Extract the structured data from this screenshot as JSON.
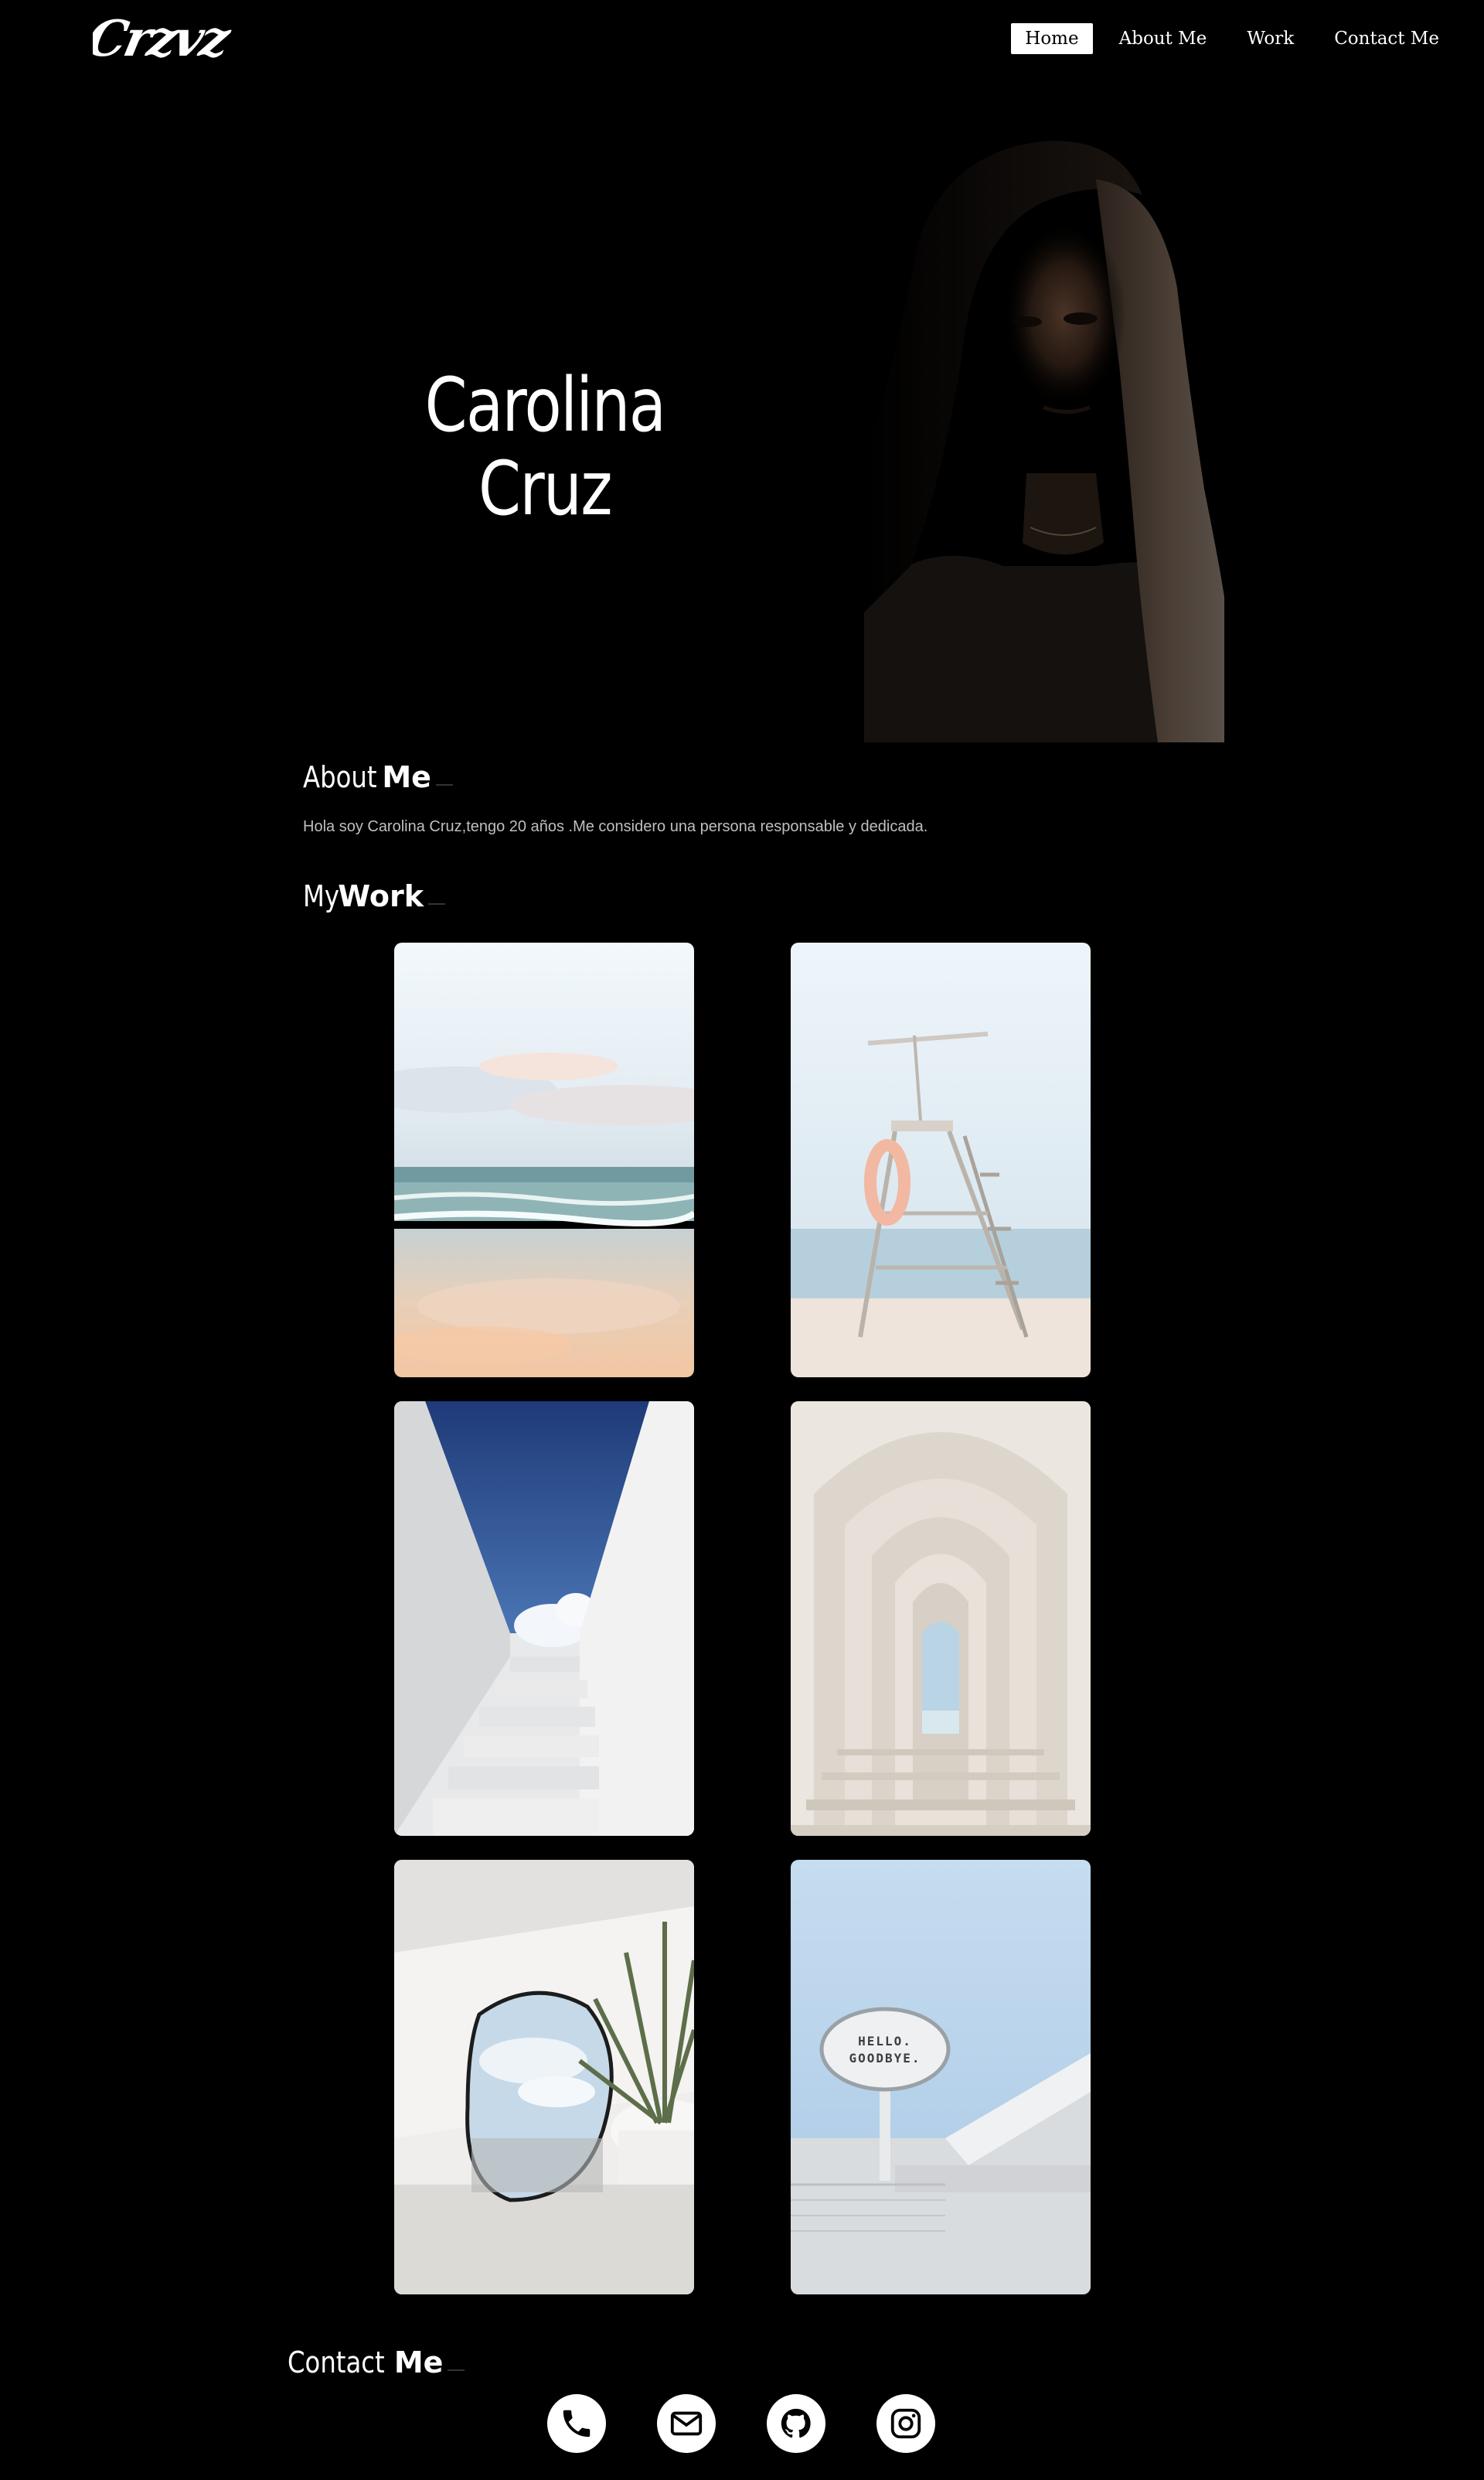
{
  "header": {
    "logo_text": "Crzvz",
    "nav": [
      {
        "label": "Home",
        "active": true
      },
      {
        "label": "About Me",
        "active": false
      },
      {
        "label": "Work",
        "active": false
      },
      {
        "label": "Contact Me",
        "active": false
      }
    ]
  },
  "hero": {
    "name_line1": "Carolina",
    "name_line2": "Cruz",
    "portrait_alt": "portrait"
  },
  "about": {
    "title_light": "About",
    "title_bold": "Me",
    "text": "Hola soy Carolina Cruz,tengo 20 años .Me considero una persona responsable y dedicada."
  },
  "work": {
    "title_light": "My",
    "title_bold": "Work",
    "items": [
      {
        "subject": "beach-shore-photo"
      },
      {
        "subject": "lifeguard-chair-photo"
      },
      {
        "subject": "white-staircase-photo"
      },
      {
        "subject": "arched-corridor-photo"
      },
      {
        "subject": "mirror-and-plant-photo"
      },
      {
        "subject": "hello-goodbye-sign-photo",
        "sign_line1": "HELLO.",
        "sign_line2": "GOODBYE."
      }
    ]
  },
  "contact": {
    "title_light": "Contact",
    "title_bold": "Me",
    "icons": [
      "phone-icon",
      "email-icon",
      "github-icon",
      "instagram-icon"
    ]
  },
  "colors": {
    "background": "#000000",
    "text": "#ffffff",
    "muted_text": "#bfbfbf",
    "nav_active_bg": "#ffffff"
  }
}
